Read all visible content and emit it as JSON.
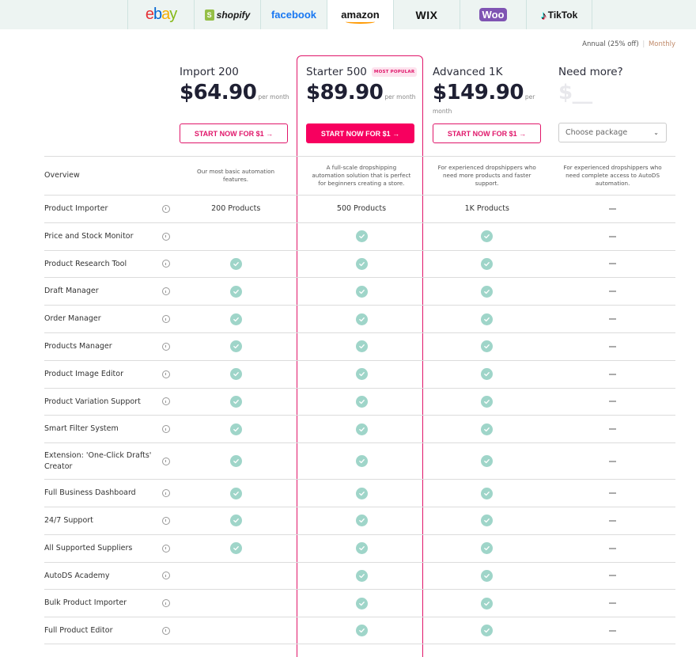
{
  "platform_tabs": [
    {
      "name": "ebay",
      "label": "ebay",
      "active": false
    },
    {
      "name": "shopify",
      "label": "shopify",
      "active": false
    },
    {
      "name": "facebook",
      "label": "facebook",
      "active": false
    },
    {
      "name": "amazon",
      "label": "amazon",
      "active": true
    },
    {
      "name": "wix",
      "label": "WIX",
      "active": false
    },
    {
      "name": "woo",
      "label": "Woo",
      "active": false
    },
    {
      "name": "tiktok",
      "label": "TikTok",
      "active": false
    }
  ],
  "billing": {
    "annual_label": "Annual (25% off)",
    "separator": "|",
    "monthly_label": "Monthly"
  },
  "plans": [
    {
      "name": "Import 200",
      "price": "$64.90",
      "period": "per month",
      "cta": "START NOW FOR $1 →",
      "description": "Our most basic automation features."
    },
    {
      "name": "Starter 500",
      "badge": "MOST POPULAR",
      "price": "$89.90",
      "period": "per month",
      "cta": "START NOW FOR $1 →",
      "description": "A full-scale dropshipping automation solution that is perfect for beginners creating a store."
    },
    {
      "name": "Advanced 1K",
      "price": "$149.90",
      "period": "per month",
      "cta": "START NOW FOR $1 →",
      "description": "For experienced dropshippers who need more products and faster support."
    },
    {
      "name": "Need more?",
      "price": "$__",
      "select_placeholder": "Choose package",
      "description": "For experienced dropshippers who need complete access to AutoDS automation."
    }
  ],
  "overview_label": "Overview",
  "features": [
    {
      "label": "Product Importer",
      "values": [
        "200 Products",
        "500 Products",
        "1K Products",
        "dash"
      ]
    },
    {
      "label": "Price and Stock Monitor",
      "values": [
        "",
        "check",
        "check",
        "dash"
      ]
    },
    {
      "label": "Product Research Tool",
      "values": [
        "check",
        "check",
        "check",
        "dash"
      ]
    },
    {
      "label": "Draft Manager",
      "values": [
        "check",
        "check",
        "check",
        "dash"
      ]
    },
    {
      "label": "Order Manager",
      "values": [
        "check",
        "check",
        "check",
        "dash"
      ]
    },
    {
      "label": "Products Manager",
      "values": [
        "check",
        "check",
        "check",
        "dash"
      ]
    },
    {
      "label": "Product Image Editor",
      "values": [
        "check",
        "check",
        "check",
        "dash"
      ]
    },
    {
      "label": "Product Variation Support",
      "values": [
        "check",
        "check",
        "check",
        "dash"
      ]
    },
    {
      "label": "Smart Filter System",
      "values": [
        "check",
        "check",
        "check",
        "dash"
      ]
    },
    {
      "label": "Extension: 'One-Click Drafts' Creator",
      "values": [
        "check",
        "check",
        "check",
        "dash"
      ]
    },
    {
      "label": "Full Business Dashboard",
      "values": [
        "check",
        "check",
        "check",
        "dash"
      ]
    },
    {
      "label": "24/7 Support",
      "values": [
        "check",
        "check",
        "check",
        "dash"
      ]
    },
    {
      "label": "All Supported Suppliers",
      "values": [
        "check",
        "check",
        "check",
        "dash"
      ]
    },
    {
      "label": "AutoDS Academy",
      "values": [
        "",
        "check",
        "check",
        "dash"
      ]
    },
    {
      "label": "Bulk Product Importer",
      "values": [
        "",
        "check",
        "check",
        "dash"
      ]
    },
    {
      "label": "Full Product Editor",
      "values": [
        "",
        "check",
        "check",
        "dash"
      ]
    }
  ],
  "colors": {
    "accent": "#e0166a",
    "cta_filled": "#f7005f",
    "check": "#9fd5c9",
    "topbar": "#edf4f2"
  }
}
